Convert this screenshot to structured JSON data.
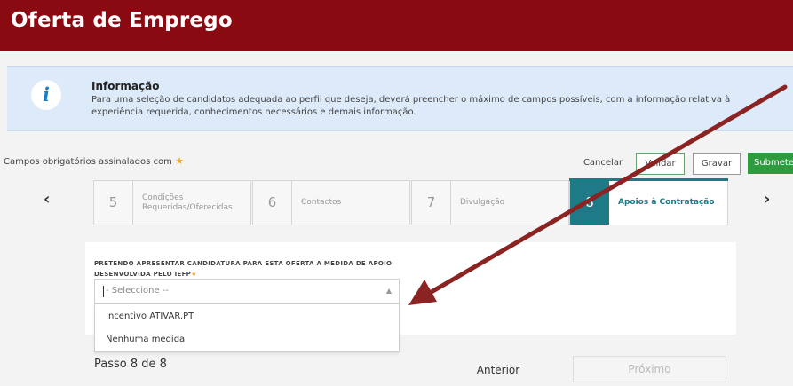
{
  "header": {
    "title": "Oferta de Emprego"
  },
  "info": {
    "icon": "info-icon",
    "icon_glyph": "i",
    "title": "Informação",
    "text": "Para uma seleção de candidatos adequada ao perfil que deseja, deverá preencher o máximo de campos possíveis, com a informação relativa à experiência requerida, conhecimentos necessários e demais informação."
  },
  "required_note": {
    "text": "Campos obrigatórios assinalados com",
    "star": "★"
  },
  "toolbar": {
    "cancel_label": "Cancelar",
    "validate_label": "Validar",
    "save_label": "Gravar",
    "submit_label": "Submeter"
  },
  "wizard": {
    "prev_arrow": "‹",
    "next_arrow": "›",
    "steps": [
      {
        "num": "5",
        "label": "Condições Requeridas/Oferecidas"
      },
      {
        "num": "6",
        "label": "Contactos"
      },
      {
        "num": "7",
        "label": "Divulgação"
      },
      {
        "num": "8",
        "label": "Apoios à Contratação",
        "active": true
      }
    ]
  },
  "form": {
    "question": "PRETENDO APRESENTAR CANDIDATURA PARA ESTA OFERTA A MEDIDA DE APOIO DESENVOLVIDA PELO IEFP",
    "question_star": "★",
    "select_value": "- Seleccione --",
    "select_chevron": "▲",
    "options": [
      "Incentivo ATIVAR.PT",
      "Nenhuma medida"
    ]
  },
  "footer": {
    "step_count": "Passo 8 de 8",
    "prev_label": "Anterior",
    "next_label": "Próximo"
  },
  "colors": {
    "header_bg": "#8a0a12",
    "accent_teal": "#1e7a86",
    "submit_green": "#2e9c3e",
    "annotation_arrow": "#8b2323"
  }
}
